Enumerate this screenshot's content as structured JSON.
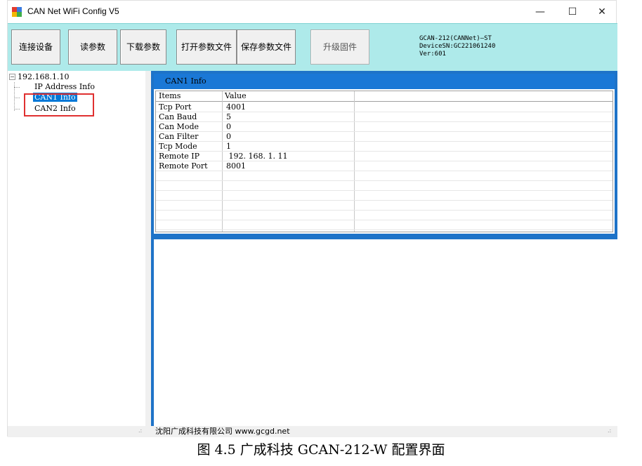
{
  "window": {
    "title": "CAN Net WiFi Config V5",
    "minimize_glyph": "—",
    "maximize_glyph": "☐",
    "close_glyph": "✕"
  },
  "toolbar": {
    "buttons": [
      {
        "label": "连接设备"
      },
      {
        "label": "读参数"
      },
      {
        "label": "下载参数"
      },
      {
        "label": "打开参数文件"
      },
      {
        "label": "保存参数文件"
      },
      {
        "label": "升级固件"
      }
    ],
    "device_info": {
      "model": "GCAN-212(CANNet)—ST",
      "serial": "DeviceSN:GC221061240",
      "version": "Ver:601"
    }
  },
  "tree": {
    "root": "192.168.1.10",
    "children": [
      {
        "label": "IP Address Info"
      },
      {
        "label": "CAN1 Info"
      },
      {
        "label": "CAN2 Info"
      }
    ],
    "toggle_glyph": "−"
  },
  "panel": {
    "header": "CAN1 Info",
    "columns": [
      "Items",
      "Value"
    ],
    "rows": [
      {
        "item": "Tcp Port",
        "value": "4001"
      },
      {
        "item": "Can Baud",
        "value": "5"
      },
      {
        "item": "Can Mode",
        "value": "0"
      },
      {
        "item": "Can Filter",
        "value": "0"
      },
      {
        "item": "Tcp Mode",
        "value": "1"
      },
      {
        "item": "Remote IP",
        "value": " 192. 168. 1. 11"
      },
      {
        "item": "Remote Port",
        "value": "8001"
      }
    ]
  },
  "statusbar": {
    "text": "沈阳广成科技有限公司   www.gcgd.net",
    "grip_glyph": ".:"
  },
  "caption": "图 4.5  广成科技 GCAN-212-W 配置界面",
  "colors": {
    "toolbar_bg": "#aeeaea",
    "panel_blue": "#1e73c8",
    "selection": "#0078d7",
    "highlight_border": "#e03030"
  }
}
